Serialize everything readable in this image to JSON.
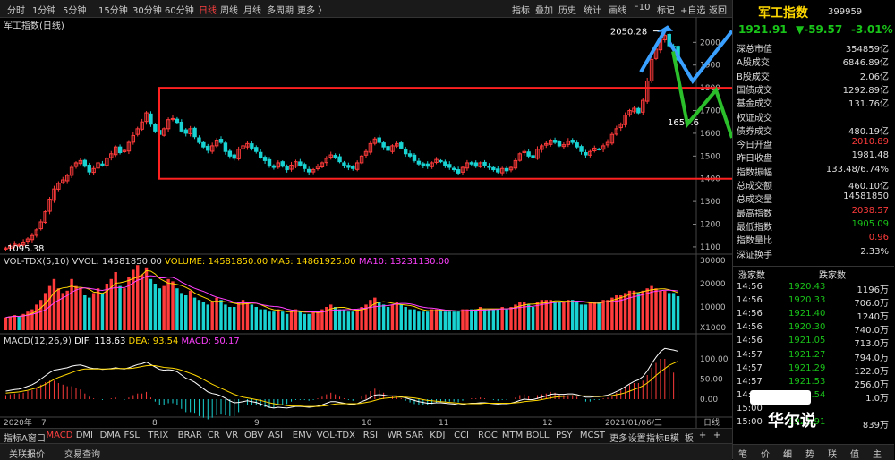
{
  "toolbar": {
    "periods": [
      "分时",
      "1分钟",
      "5分钟",
      "15分钟",
      "30分钟",
      "60分钟",
      "日线",
      "周线",
      "月线",
      "多周期",
      "更多 〉"
    ],
    "active_period": "日线",
    "right_buttons": [
      "指标",
      "叠加",
      "历史",
      "统计",
      "画线",
      "F10",
      "标记",
      "+自选",
      "返回"
    ]
  },
  "chart_title": "军工指数(日线)",
  "annotations": {
    "high_label": "2050.28",
    "low_label": "1095.38",
    "mid_label": "1650.6"
  },
  "y_ticks_main": [
    "2000",
    "1900",
    "1800",
    "1700",
    "1600",
    "1500",
    "1400",
    "1300",
    "1200",
    "1100"
  ],
  "vol_header": {
    "name": "VOL-TDX(5,10)",
    "vvol": "VVOL: 14581850.00",
    "volume": "VOLUME: 14581850.00",
    "ma5": "MA5: 14861925.00",
    "ma10": "MA10: 13231130.00"
  },
  "y_ticks_vol": [
    "30000",
    "20000",
    "10000"
  ],
  "vol_unit": "X1000",
  "macd_header": {
    "name": "MACD(12,26,9)",
    "dif": "DIF: 118.63",
    "dea": "DEA: 93.54",
    "macd": "MACD: 50.17"
  },
  "y_ticks_macd": [
    "100.00",
    "50.00",
    "0.00"
  ],
  "x_labels": [
    "2020年",
    "7",
    "8",
    "9",
    "10",
    "11",
    "12",
    "2021/01/06/三",
    "日线"
  ],
  "bottom_tabs": [
    "指标A",
    "窗口",
    "MACD",
    "DMI",
    "DMA",
    "FSL",
    "TRIX",
    "BRAR",
    "CR",
    "VR",
    "OBV",
    "ASI",
    "EMV",
    "VOL-TDX",
    "RSI",
    "WR",
    "SAR",
    "KDJ",
    "CCI",
    "ROC",
    "MTM",
    "BOLL",
    "PSY",
    "MCST",
    "更多",
    "设置",
    "指标B",
    "模",
    "板",
    "+",
    "+"
  ],
  "active_tab": "MACD",
  "status_bar": [
    "关联报价",
    "交易查询"
  ],
  "side": {
    "name": "军工指数",
    "code": "399959",
    "price": "1921.91",
    "change": "▼-59.57",
    "pct": "-3.01%",
    "rows": [
      {
        "k": "深总市值",
        "v": "354859亿",
        "c": ""
      },
      {
        "k": "A股成交",
        "v": "6846.89亿",
        "c": ""
      },
      {
        "k": "B股成交",
        "v": "2.06亿",
        "c": ""
      },
      {
        "k": "国债成交",
        "v": "1292.89亿",
        "c": ""
      },
      {
        "k": "基金成交",
        "v": "131.76亿",
        "c": ""
      },
      {
        "k": "权证成交",
        "v": "",
        "c": ""
      },
      {
        "k": "债券成交",
        "v": "480.19亿",
        "c": ""
      },
      {
        "k": "今日开盘",
        "v": "2010.89",
        "c": "red"
      },
      {
        "k": "昨日收盘",
        "v": "1981.48",
        "c": ""
      },
      {
        "k": "指数振幅",
        "v": "133.48/6.74%",
        "c": ""
      },
      {
        "k": "总成交额",
        "v": "460.10亿",
        "c": ""
      },
      {
        "k": "总成交量",
        "v": "14581850",
        "c": ""
      },
      {
        "k": "最高指数",
        "v": "2038.57",
        "c": "red"
      },
      {
        "k": "最低指数",
        "v": "1905.09",
        "c": "green"
      },
      {
        "k": "指数量比",
        "v": "0.96",
        "c": "red"
      },
      {
        "k": "深证换手",
        "v": "2.33%",
        "c": ""
      }
    ],
    "breadth_header": [
      "涨家数",
      "跌家数"
    ],
    "ticks": [
      {
        "t": "14:56",
        "p": "1920.43",
        "v": "1196万"
      },
      {
        "t": "14:56",
        "p": "1920.33",
        "v": "706.0万"
      },
      {
        "t": "14:56",
        "p": "1921.40",
        "v": "1240万"
      },
      {
        "t": "14:56",
        "p": "1920.30",
        "v": "740.0万"
      },
      {
        "t": "14:56",
        "p": "1921.05",
        "v": "713.0万"
      },
      {
        "t": "14:57",
        "p": "1921.27",
        "v": "794.0万"
      },
      {
        "t": "14:57",
        "p": "1921.29",
        "v": "122.0万"
      },
      {
        "t": "14:57",
        "p": "1921.53",
        "v": "256.0万"
      },
      {
        "t": "14:57",
        "p": "1921.54",
        "v": "1.0万"
      },
      {
        "t": "15:00",
        "p": "",
        "v": ""
      },
      {
        "t": "15:00",
        "p": "1921.91",
        "v": "839万"
      }
    ],
    "bottom_tabs": [
      "笔",
      "价",
      "细",
      "势",
      "联",
      "值",
      "主"
    ]
  },
  "watermark": "华尔说",
  "colors": {
    "up": "#ff3b3b",
    "down": "#19d3d3",
    "ma_white": "#ffffff",
    "ma_yellow": "#ffd700",
    "ma_magenta": "#ff40ff",
    "box": "#ff2020",
    "arrow_blue": "#3aa0ff",
    "arrow_green": "#2bbf2b"
  },
  "chart_data": {
    "type": "candlestick",
    "title": "军工指数(日线)",
    "ylim": [
      1080,
      2080
    ],
    "close": [
      1095,
      1103,
      1112,
      1108,
      1121,
      1135,
      1150,
      1175,
      1210,
      1255,
      1310,
      1355,
      1380,
      1395,
      1415,
      1450,
      1470,
      1480,
      1455,
      1430,
      1445,
      1470,
      1460,
      1490,
      1510,
      1540,
      1515,
      1525,
      1560,
      1590,
      1620,
      1650,
      1690,
      1640,
      1610,
      1595,
      1620,
      1660,
      1665,
      1648,
      1610,
      1600,
      1620,
      1585,
      1560,
      1540,
      1525,
      1545,
      1570,
      1560,
      1520,
      1500,
      1490,
      1530,
      1545,
      1555,
      1535,
      1520,
      1495,
      1480,
      1460,
      1450,
      1470,
      1455,
      1440,
      1460,
      1475,
      1460,
      1445,
      1430,
      1440,
      1455,
      1470,
      1490,
      1505,
      1495,
      1475,
      1460,
      1450,
      1445,
      1470,
      1500,
      1520,
      1555,
      1575,
      1560,
      1540,
      1525,
      1545,
      1555,
      1535,
      1510,
      1500,
      1480,
      1465,
      1460,
      1455,
      1470,
      1485,
      1475,
      1460,
      1450,
      1440,
      1425,
      1450,
      1470,
      1465,
      1455,
      1470,
      1460,
      1450,
      1440,
      1430,
      1445,
      1435,
      1450,
      1480,
      1510,
      1520,
      1500,
      1495,
      1530,
      1545,
      1555,
      1570,
      1560,
      1545,
      1550,
      1565,
      1560,
      1540,
      1520,
      1505,
      1520,
      1535,
      1530,
      1545,
      1560,
      1595,
      1620,
      1640,
      1680,
      1700,
      1710,
      1690,
      1745,
      1830,
      1925,
      1970,
      2010,
      2030,
      1985,
      1981,
      1922
    ],
    "volume": [
      5.5,
      6,
      6.5,
      5.8,
      7,
      8,
      9,
      11,
      13,
      16,
      19,
      22,
      18,
      16,
      17,
      22,
      19,
      18,
      15,
      14,
      16,
      18,
      16,
      20,
      22,
      25,
      19,
      18,
      23,
      26,
      28,
      24,
      27,
      22,
      20,
      18,
      19,
      22,
      21,
      18,
      16,
      15,
      17,
      14,
      13,
      12,
      11,
      12,
      14,
      13,
      11,
      10,
      10,
      12,
      13,
      12,
      11,
      10,
      9,
      9,
      8,
      8,
      9,
      8,
      7,
      8,
      9,
      8,
      7,
      7,
      8,
      8,
      9,
      10,
      11,
      10,
      9,
      9,
      8,
      8,
      9,
      10,
      11,
      13,
      14,
      12,
      11,
      10,
      11,
      12,
      11,
      10,
      9,
      9,
      8,
      8,
      8,
      9,
      9,
      9,
      8,
      8,
      8,
      8,
      9,
      9,
      9,
      9,
      10,
      9,
      9,
      9,
      9,
      10,
      9,
      10,
      11,
      12,
      12,
      11,
      10,
      12,
      13,
      13,
      13,
      12,
      12,
      12,
      13,
      13,
      12,
      11,
      11,
      12,
      12,
      12,
      13,
      13,
      14,
      15,
      15,
      16,
      17,
      17,
      16,
      17,
      18,
      19,
      18,
      17,
      17,
      16,
      16,
      14.6
    ],
    "macd_dif": [
      20,
      22,
      24,
      25,
      28,
      32,
      36,
      42,
      50,
      58,
      66,
      72,
      74,
      76,
      78,
      82,
      84,
      85,
      82,
      78,
      76,
      76,
      74,
      75,
      76,
      78,
      76,
      75,
      78,
      82,
      86,
      88,
      92,
      86,
      80,
      74,
      72,
      73,
      72,
      68,
      60,
      52,
      48,
      42,
      34,
      26,
      18,
      14,
      12,
      8,
      2,
      -4,
      -9,
      -8,
      -6,
      -4,
      -6,
      -8,
      -12,
      -16,
      -20,
      -22,
      -20,
      -21,
      -22,
      -20,
      -18,
      -18,
      -19,
      -20,
      -19,
      -17,
      -14,
      -10,
      -6,
      -6,
      -8,
      -10,
      -12,
      -13,
      -11,
      -6,
      -2,
      4,
      10,
      11,
      10,
      8,
      8,
      8,
      6,
      3,
      0,
      -3,
      -6,
      -8,
      -10,
      -10,
      -9,
      -9,
      -10,
      -11,
      -12,
      -14,
      -13,
      -11,
      -10,
      -10,
      -9,
      -9,
      -10,
      -11,
      -12,
      -11,
      -11,
      -10,
      -7,
      -3,
      0,
      -1,
      -1,
      2,
      5,
      8,
      12,
      13,
      12,
      12,
      13,
      13,
      11,
      8,
      5,
      5,
      6,
      6,
      8,
      10,
      14,
      19,
      24,
      31,
      38,
      44,
      48,
      56,
      70,
      88,
      104,
      118,
      126,
      124,
      122,
      119
    ],
    "macd_dea": [
      15,
      16,
      17,
      18,
      20,
      22,
      25,
      28,
      32,
      37,
      43,
      49,
      54,
      58,
      62,
      66,
      70,
      73,
      75,
      75,
      75,
      75,
      75,
      75,
      75,
      76,
      76,
      76,
      76,
      77,
      79,
      81,
      83,
      84,
      83,
      81,
      79,
      78,
      77,
      75,
      72,
      68,
      64,
      60,
      55,
      49,
      43,
      37,
      32,
      27,
      22,
      17,
      12,
      8,
      5,
      3,
      1,
      -1,
      -3,
      -6,
      -9,
      -11,
      -13,
      -14,
      -16,
      -17,
      -17,
      -17,
      -18,
      -18,
      -18,
      -18,
      -17,
      -16,
      -14,
      -12,
      -11,
      -11,
      -11,
      -11,
      -11,
      -10,
      -8,
      -6,
      -3,
      0,
      2,
      3,
      4,
      5,
      5,
      5,
      4,
      3,
      1,
      -1,
      -3,
      -4,
      -5,
      -6,
      -7,
      -8,
      -9,
      -10,
      -11,
      -11,
      -11,
      -11,
      -11,
      -10,
      -10,
      -10,
      -10,
      -10,
      -10,
      -10,
      -9,
      -8,
      -6,
      -5,
      -4,
      -3,
      -1,
      1,
      3,
      5,
      6,
      7,
      8,
      8,
      8,
      8,
      8,
      8,
      7,
      7,
      7,
      8,
      9,
      11,
      13,
      16,
      20,
      24,
      28,
      33,
      40,
      49,
      59,
      68,
      76,
      84,
      89,
      94
    ]
  }
}
